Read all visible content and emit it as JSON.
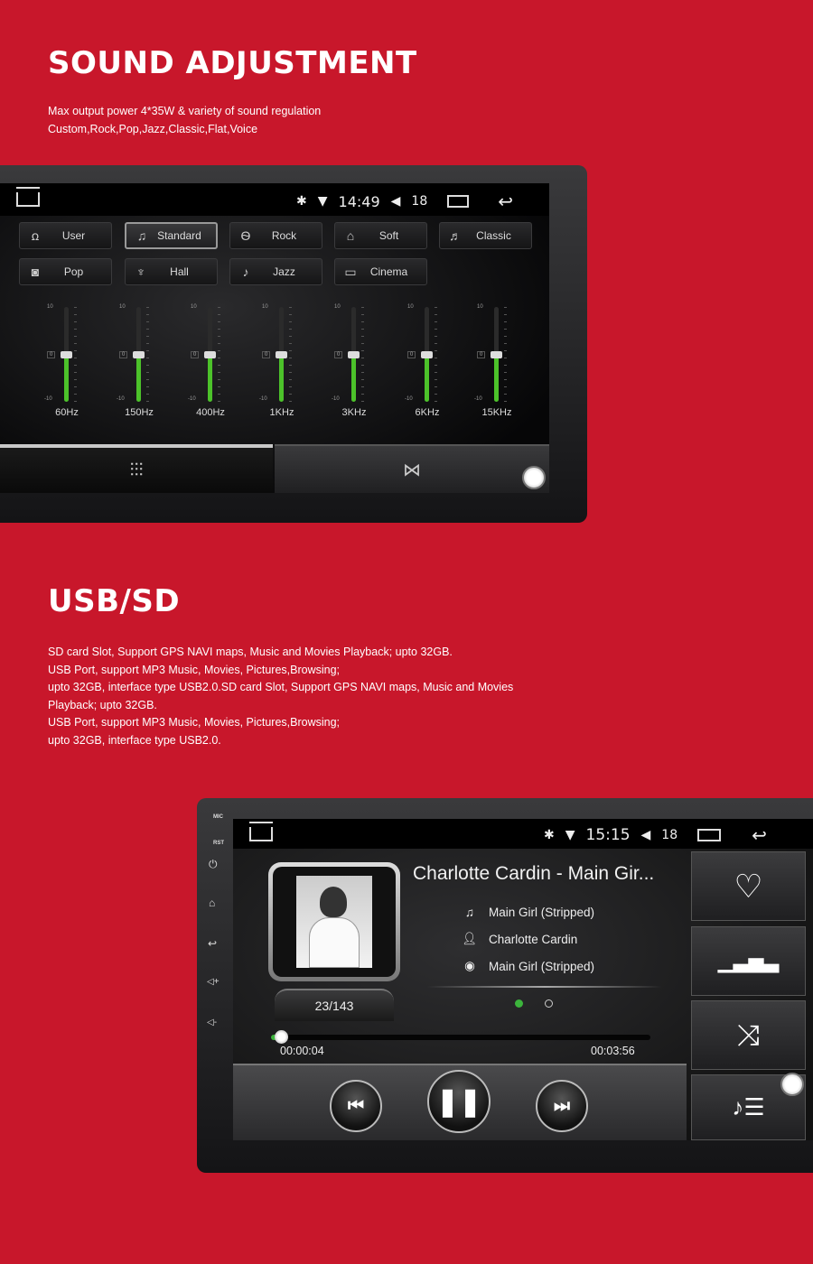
{
  "brand_color": "#c8172b",
  "section1": {
    "title": "SOUND ADJUSTMENT",
    "lines": [
      "Max output power 4*35W & variety of sound regulation",
      "Custom,Rock,Pop,Jazz,Classic,Flat,Voice"
    ]
  },
  "eq_screen": {
    "status": {
      "time": "14:49",
      "volume": "18",
      "icons": [
        "home-icon",
        "bluetooth-icon",
        "wifi-icon",
        "volume-icon",
        "recent-apps-icon",
        "back-icon"
      ]
    },
    "presets": [
      {
        "label": "User",
        "icon": "users-icon",
        "selected": false
      },
      {
        "label": "Standard",
        "icon": "music-note-icon",
        "selected": true
      },
      {
        "label": "Rock",
        "icon": "drum-icon",
        "selected": false
      },
      {
        "label": "Soft",
        "icon": "piano-icon",
        "selected": false
      },
      {
        "label": "Classic",
        "icon": "gramophone-icon",
        "selected": false
      },
      {
        "label": "Pop",
        "icon": "speaker-icon",
        "selected": false
      },
      {
        "label": "Hall",
        "icon": "hall-icon",
        "selected": false
      },
      {
        "label": "Jazz",
        "icon": "saxophone-icon",
        "selected": false
      },
      {
        "label": "Cinema",
        "icon": "cinema-icon",
        "selected": false
      }
    ],
    "scale": {
      "max": "10",
      "mid": "0",
      "min": "-10"
    },
    "bands": [
      {
        "label": "60Hz",
        "value": 0
      },
      {
        "label": "150Hz",
        "value": 0
      },
      {
        "label": "400Hz",
        "value": 0
      },
      {
        "label": "1KHz",
        "value": 0
      },
      {
        "label": "3KHz",
        "value": 0
      },
      {
        "label": "6KHz",
        "value": 0
      },
      {
        "label": "15KHz",
        "value": 0
      }
    ],
    "tabs": [
      {
        "icon": "equalizer-icon",
        "active": true
      },
      {
        "icon": "sound-field-icon",
        "active": false
      }
    ]
  },
  "section2": {
    "title": "USB/SD",
    "lines": [
      "SD card Slot, Support GPS NAVI maps, Music and Movies Playback; upto 32GB.",
      "USB Port, support MP3 Music, Movies, Pictures,Browsing;",
      "upto 32GB, interface type USB2.0.SD card Slot, Support GPS NAVI maps, Music and Movies",
      "Playback; upto 32GB.",
      "USB Port, support MP3 Music, Movies, Pictures,Browsing;",
      "upto 32GB, interface type USB2.0."
    ]
  },
  "music_screen": {
    "side_labels": {
      "mic": "MIC",
      "rst": "RST"
    },
    "status": {
      "time": "15:15",
      "volume": "18"
    },
    "title": "Charlotte Cardin - Main Gir...",
    "song": "Main Girl (Stripped)",
    "artist": "Charlotte Cardin",
    "album": "Main Girl (Stripped)",
    "track_counter": "23/143",
    "elapsed": "00:00:04",
    "duration": "00:03:56",
    "progress_percent": 2,
    "page_dots": {
      "count": 2,
      "active": 1
    },
    "side_buttons": [
      "favorite-heart-icon",
      "equalizer-icon",
      "shuffle-icon",
      "playlist-icon"
    ],
    "controls": [
      "previous-icon",
      "pause-icon",
      "next-icon"
    ]
  }
}
